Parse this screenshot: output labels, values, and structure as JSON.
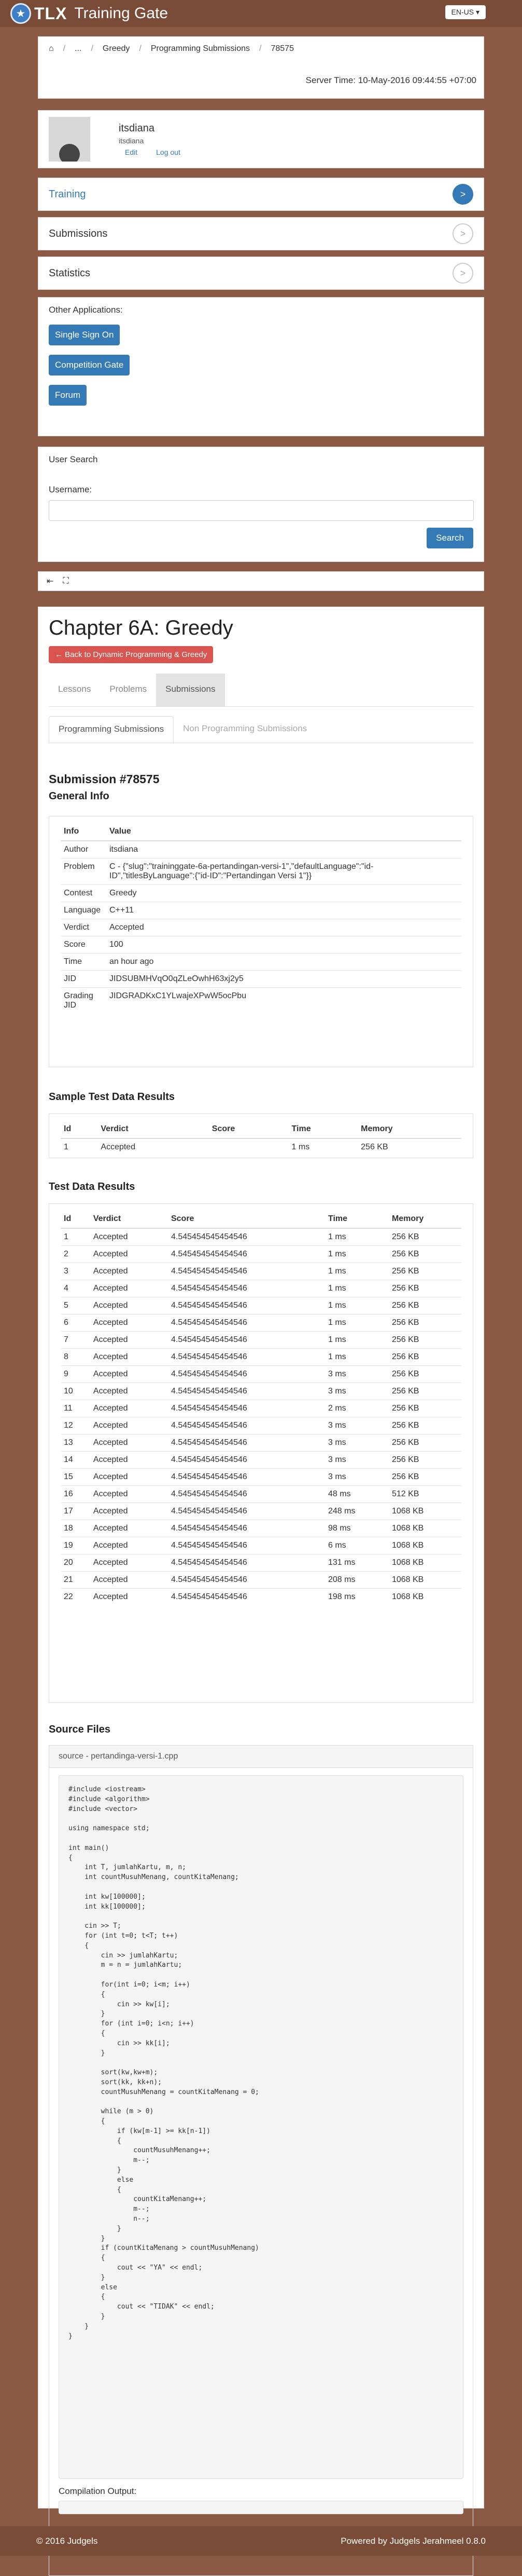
{
  "header": {
    "logo_text": "TLX",
    "app_title": "Training Gate",
    "language": "EN-US ▾"
  },
  "breadcrumb": {
    "items": [
      "...",
      "Greedy",
      "Programming Submissions",
      "78575"
    ],
    "server_time": "Server Time: 10-May-2016 09:44:55 +07:00"
  },
  "user": {
    "username": "itsdiana",
    "display_name": "itsdiana",
    "edit_label": "Edit",
    "logout_label": "Log out"
  },
  "menu": [
    {
      "label": "Training",
      "active": true
    },
    {
      "label": "Submissions",
      "active": false
    },
    {
      "label": "Statistics",
      "active": false
    }
  ],
  "other_apps": {
    "label": "Other Applications:",
    "buttons": [
      "Single Sign On",
      "Competition Gate",
      "Forum"
    ]
  },
  "user_search": {
    "title": "User Search",
    "label": "Username:",
    "button": "Search"
  },
  "content": {
    "chapter_title": "Chapter 6A: Greedy",
    "back_label": "← Back to Dynamic Programming & Greedy",
    "tabs": [
      "Lessons",
      "Problems",
      "Submissions"
    ],
    "subtabs": [
      "Programming Submissions",
      "Non Programming Submissions"
    ],
    "submission_title": "Submission #78575",
    "general_info_title": "General Info",
    "info_headers": [
      "Info",
      "Value"
    ],
    "info": [
      {
        "k": "Author",
        "v": "itsdiana"
      },
      {
        "k": "Problem",
        "v": "C - {\"slug\":\"traininggate-6a-pertandingan-versi-1\",\"defaultLanguage\":\"id-ID\",\"titlesByLanguage\":{\"id-ID\":\"Pertandingan Versi 1\"}}"
      },
      {
        "k": "Contest",
        "v": "Greedy"
      },
      {
        "k": "Language",
        "v": "C++11"
      },
      {
        "k": "Verdict",
        "v": "Accepted"
      },
      {
        "k": "Score",
        "v": "100"
      },
      {
        "k": "Time",
        "v": "an hour ago"
      },
      {
        "k": "JID",
        "v": "JIDSUBMHVqO0qZLeOwhH63xj2y5"
      },
      {
        "k": "Grading JID",
        "v": "JIDGRADKxC1YLwajeXPwW5ocPbu"
      }
    ],
    "sample_title": "Sample Test Data Results",
    "sample_headers": [
      "Id",
      "Verdict",
      "Score",
      "Time",
      "Memory"
    ],
    "sample_rows": [
      [
        "1",
        "Accepted",
        "",
        "1 ms",
        "256 KB"
      ]
    ],
    "tests_title": "Test Data Results",
    "tests_headers": [
      "Id",
      "Verdict",
      "Score",
      "Time",
      "Memory"
    ],
    "tests_rows": [
      [
        "1",
        "Accepted",
        "4.545454545454546",
        "1 ms",
        "256 KB"
      ],
      [
        "2",
        "Accepted",
        "4.545454545454546",
        "1 ms",
        "256 KB"
      ],
      [
        "3",
        "Accepted",
        "4.545454545454546",
        "1 ms",
        "256 KB"
      ],
      [
        "4",
        "Accepted",
        "4.545454545454546",
        "1 ms",
        "256 KB"
      ],
      [
        "5",
        "Accepted",
        "4.545454545454546",
        "1 ms",
        "256 KB"
      ],
      [
        "6",
        "Accepted",
        "4.545454545454546",
        "1 ms",
        "256 KB"
      ],
      [
        "7",
        "Accepted",
        "4.545454545454546",
        "1 ms",
        "256 KB"
      ],
      [
        "8",
        "Accepted",
        "4.545454545454546",
        "1 ms",
        "256 KB"
      ],
      [
        "9",
        "Accepted",
        "4.545454545454546",
        "3 ms",
        "256 KB"
      ],
      [
        "10",
        "Accepted",
        "4.545454545454546",
        "3 ms",
        "256 KB"
      ],
      [
        "11",
        "Accepted",
        "4.545454545454546",
        "2 ms",
        "256 KB"
      ],
      [
        "12",
        "Accepted",
        "4.545454545454546",
        "3 ms",
        "256 KB"
      ],
      [
        "13",
        "Accepted",
        "4.545454545454546",
        "3 ms",
        "256 KB"
      ],
      [
        "14",
        "Accepted",
        "4.545454545454546",
        "3 ms",
        "256 KB"
      ],
      [
        "15",
        "Accepted",
        "4.545454545454546",
        "3 ms",
        "256 KB"
      ],
      [
        "16",
        "Accepted",
        "4.545454545454546",
        "48 ms",
        "512 KB"
      ],
      [
        "17",
        "Accepted",
        "4.545454545454546",
        "248 ms",
        "1068 KB"
      ],
      [
        "18",
        "Accepted",
        "4.545454545454546",
        "98 ms",
        "1068 KB"
      ],
      [
        "19",
        "Accepted",
        "4.545454545454546",
        "6 ms",
        "1068 KB"
      ],
      [
        "20",
        "Accepted",
        "4.545454545454546",
        "131 ms",
        "1068 KB"
      ],
      [
        "21",
        "Accepted",
        "4.545454545454546",
        "208 ms",
        "1068 KB"
      ],
      [
        "22",
        "Accepted",
        "4.545454545454546",
        "198 ms",
        "1068 KB"
      ]
    ],
    "source_title": "Source Files",
    "source_file": "source - pertandinga-versi-1.cpp",
    "source_code": "#include <iostream>\n#include <algorithm>\n#include <vector>\n\nusing namespace std;\n\nint main()\n{\n    int T, jumlahKartu, m, n;\n    int countMusuhMenang, countKitaMenang;\n\n    int kw[100000];\n    int kk[100000];\n\n    cin >> T;\n    for (int t=0; t<T; t++)\n    {\n        cin >> jumlahKartu;\n        m = n = jumlahKartu;\n\n        for(int i=0; i<m; i++)\n        {\n            cin >> kw[i];\n        }\n        for (int i=0; i<n; i++)\n        {\n            cin >> kk[i];\n        }\n\n        sort(kw,kw+m);\n        sort(kk, kk+n);\n        countMusuhMenang = countKitaMenang = 0;\n\n        while (m > 0)\n        {\n            if (kw[m-1] >= kk[n-1])\n            {\n                countMusuhMenang++;\n                m--;\n            }\n            else\n            {\n                countKitaMenang++;\n                m--;\n                n--;\n            }\n        }\n        if (countKitaMenang > countMusuhMenang)\n        {\n            cout << \"YA\" << endl;\n        }\n        else\n        {\n            cout << \"TIDAK\" << endl;\n        }\n    }\n}",
    "compilation_label": "Compilation Output:"
  },
  "footer": {
    "left": "© 2016 Judgels",
    "right": "Powered by Judgels Jerahmeel 0.8.0"
  }
}
